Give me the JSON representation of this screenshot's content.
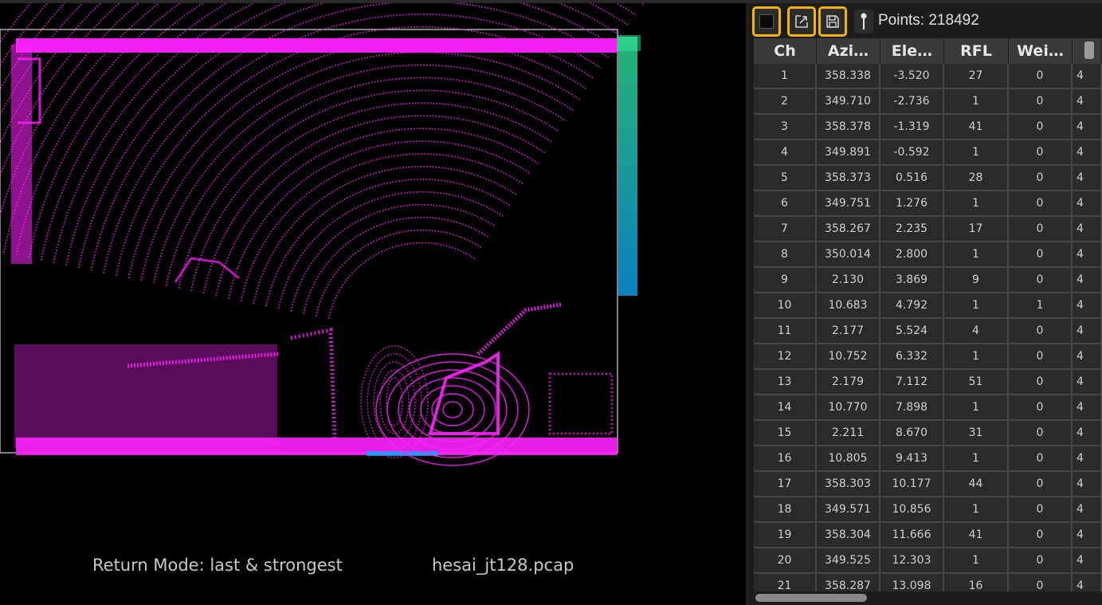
{
  "viewer": {
    "return_mode": "Return Mode: last & strongest",
    "filename": "hesai_jt128.pcap",
    "colors": {
      "primary_points": "#ff22ff",
      "secondary_points_top": "#33ee99",
      "secondary_points_bottom": "#11aaff",
      "box_outline": "#ffffff"
    }
  },
  "toolbar": {
    "stop_icon": "stop-square-icon",
    "export_icon": "export-icon",
    "save_icon": "save-icon",
    "pin_icon": "pin-icon",
    "points_label": "Points: 218492",
    "highlight_color": "#f4b400"
  },
  "table": {
    "headers": [
      "Ch",
      "Azi…",
      "Ele…",
      "RFL",
      "Wei…",
      ""
    ],
    "rows": [
      [
        "1",
        "358.338",
        "-3.520",
        "27",
        "0",
        "4"
      ],
      [
        "2",
        "349.710",
        "-2.736",
        "1",
        "0",
        "4"
      ],
      [
        "3",
        "358.378",
        "-1.319",
        "41",
        "0",
        "4"
      ],
      [
        "4",
        "349.891",
        "-0.592",
        "1",
        "0",
        "4"
      ],
      [
        "5",
        "358.373",
        "0.516",
        "28",
        "0",
        "4"
      ],
      [
        "6",
        "349.751",
        "1.276",
        "1",
        "0",
        "4"
      ],
      [
        "7",
        "358.267",
        "2.235",
        "17",
        "0",
        "4"
      ],
      [
        "8",
        "350.014",
        "2.800",
        "1",
        "0",
        "4"
      ],
      [
        "9",
        "2.130",
        "3.869",
        "9",
        "0",
        "4"
      ],
      [
        "10",
        "10.683",
        "4.792",
        "1",
        "1",
        "4"
      ],
      [
        "11",
        "2.177",
        "5.524",
        "4",
        "0",
        "4"
      ],
      [
        "12",
        "10.752",
        "6.332",
        "1",
        "0",
        "4"
      ],
      [
        "13",
        "2.179",
        "7.112",
        "51",
        "0",
        "4"
      ],
      [
        "14",
        "10.770",
        "7.898",
        "1",
        "0",
        "4"
      ],
      [
        "15",
        "2.211",
        "8.670",
        "31",
        "0",
        "4"
      ],
      [
        "16",
        "10.805",
        "9.413",
        "1",
        "0",
        "4"
      ],
      [
        "17",
        "358.303",
        "10.177",
        "44",
        "0",
        "4"
      ],
      [
        "18",
        "349.571",
        "10.856",
        "1",
        "0",
        "4"
      ],
      [
        "19",
        "358.304",
        "11.666",
        "41",
        "0",
        "4"
      ],
      [
        "20",
        "349.525",
        "12.303",
        "1",
        "0",
        "4"
      ],
      [
        "21",
        "358.287",
        "13.098",
        "16",
        "0",
        "4"
      ]
    ]
  }
}
